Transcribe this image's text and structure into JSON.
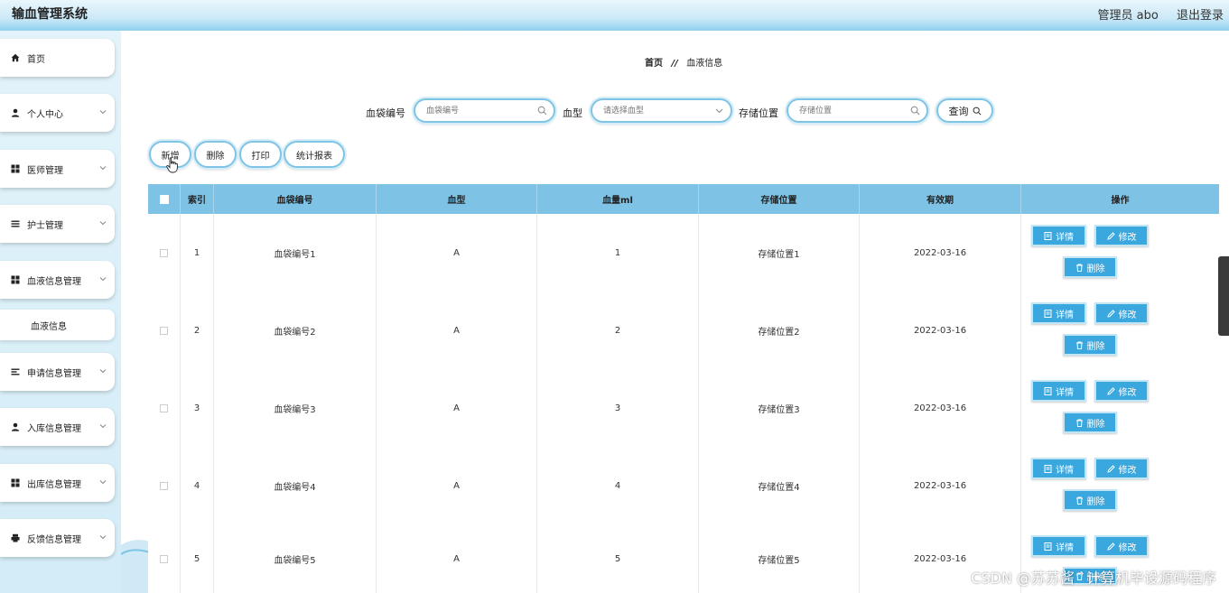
{
  "header": {
    "app_title": "输血管理系统",
    "user": "管理员 abo",
    "logout": "退出登录"
  },
  "sidebar": {
    "items": [
      {
        "label": "首页",
        "icon": "home-icon",
        "expandable": false
      },
      {
        "label": "个人中心",
        "icon": "user-icon",
        "expandable": true
      },
      {
        "label": "医师管理",
        "icon": "grid-icon",
        "expandable": true
      },
      {
        "label": "护士管理",
        "icon": "list-icon",
        "expandable": true
      },
      {
        "label": "血液信息管理",
        "icon": "grid-icon",
        "expandable": true
      },
      {
        "label": "申请信息管理",
        "icon": "list-icon",
        "expandable": true
      },
      {
        "label": "入库信息管理",
        "icon": "user-icon",
        "expandable": true
      },
      {
        "label": "出库信息管理",
        "icon": "grid-icon",
        "expandable": true
      },
      {
        "label": "反馈信息管理",
        "icon": "print-icon",
        "expandable": true
      }
    ],
    "sub_item": "血液信息"
  },
  "breadcrumb": {
    "home": "首页",
    "separator": "//",
    "current": "血液信息"
  },
  "search": {
    "bag_no_label": "血袋编号",
    "bag_no_placeholder": "血袋编号",
    "blood_type_label": "血型",
    "blood_type_placeholder": "请选择血型",
    "location_label": "存储位置",
    "location_placeholder": "存储位置",
    "query_label": "查询"
  },
  "toolbar": {
    "add": "新增",
    "delete": "删除",
    "print": "打印",
    "report": "统计报表"
  },
  "table": {
    "headers": [
      "索引",
      "血袋编号",
      "血型",
      "血量ml",
      "存储位置",
      "有效期",
      "操作"
    ],
    "rows": [
      {
        "index": "1",
        "bag_no": "血袋编号1",
        "blood_type": "A",
        "volume": "1",
        "location": "存储位置1",
        "expiry": "2022-03-16"
      },
      {
        "index": "2",
        "bag_no": "血袋编号2",
        "blood_type": "A",
        "volume": "2",
        "location": "存储位置2",
        "expiry": "2022-03-16"
      },
      {
        "index": "3",
        "bag_no": "血袋编号3",
        "blood_type": "A",
        "volume": "3",
        "location": "存储位置3",
        "expiry": "2022-03-16"
      },
      {
        "index": "4",
        "bag_no": "血袋编号4",
        "blood_type": "A",
        "volume": "4",
        "location": "存储位置4",
        "expiry": "2022-03-16"
      },
      {
        "index": "5",
        "bag_no": "血袋编号5",
        "blood_type": "A",
        "volume": "5",
        "location": "存储位置5",
        "expiry": "2022-03-16"
      }
    ],
    "actions": {
      "detail": "详情",
      "edit": "修改",
      "delete": "删除"
    }
  },
  "watermark": "CSDN @苏苏酱   `计算机毕设源码程序",
  "colors": {
    "header_blue": "#8fd0ee",
    "table_head": "#7ec3e6",
    "action_button": "#3aa7de"
  }
}
